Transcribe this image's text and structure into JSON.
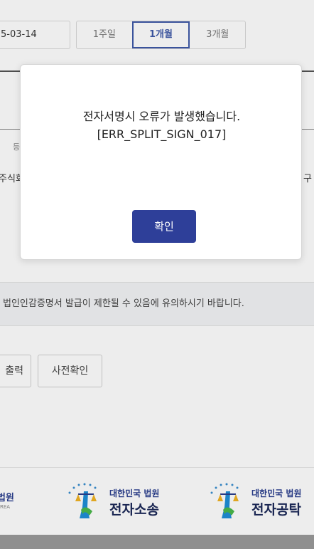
{
  "filter": {
    "date_value": "5-03-14",
    "period_buttons": [
      "1주일",
      "1개월",
      "3개월"
    ]
  },
  "table": {
    "header_fragment": "등",
    "row_fragment_left": "주식회",
    "row_fragment_right": "구"
  },
  "notice": {
    "text": "법인인감증명서 발급이 제한될 수 있음에 유의하시기 바랍니다."
  },
  "actions": {
    "print_label": "출력",
    "preview_label": "사전확인"
  },
  "footer": {
    "logo_left": {
      "title": "법원",
      "sub": "REA"
    },
    "logo_mid": {
      "title": "대한민국 법원",
      "name": "전자소송"
    },
    "logo_right": {
      "title": "대한민국 법원",
      "name": "전자공탁"
    }
  },
  "modal": {
    "message": "전자서명시 오류가 발생했습니다.[ERR_SPLIT_SIGN_017]",
    "confirm_label": "확인"
  },
  "colors": {
    "accent": "#2e3f99",
    "active_tab": "#3f5aa8"
  }
}
